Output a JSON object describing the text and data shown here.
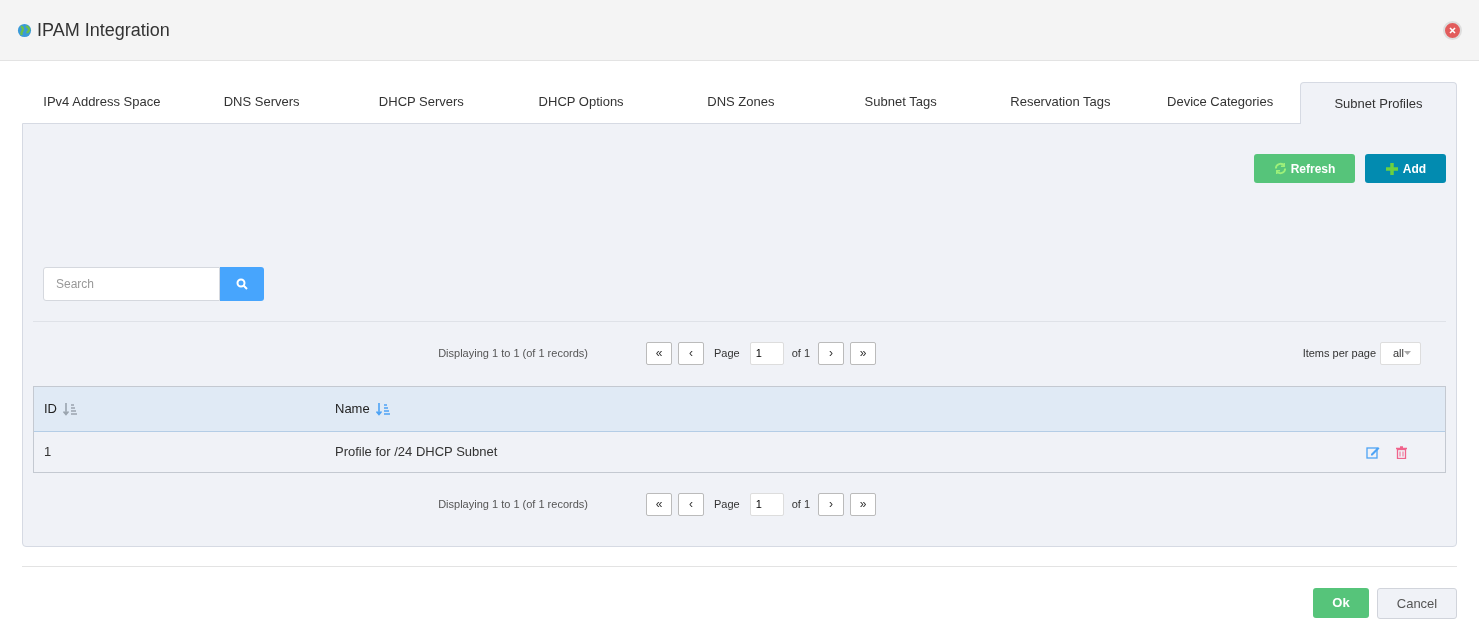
{
  "window": {
    "title": "IPAM Integration"
  },
  "tabs": [
    {
      "label": "IPv4 Address Space",
      "selected": false
    },
    {
      "label": "DNS Servers",
      "selected": false
    },
    {
      "label": "DHCP Servers",
      "selected": false
    },
    {
      "label": "DHCP Options",
      "selected": false
    },
    {
      "label": "DNS Zones",
      "selected": false
    },
    {
      "label": "Subnet Tags",
      "selected": false
    },
    {
      "label": "Reservation Tags",
      "selected": false
    },
    {
      "label": "Device Categories",
      "selected": false
    },
    {
      "label": "Subnet Profiles",
      "selected": true
    }
  ],
  "toolbar": {
    "refresh": "Refresh",
    "add": "Add"
  },
  "search": {
    "placeholder": "Search"
  },
  "pager_top": {
    "summary": "Displaying 1 to 1 (of 1 records)",
    "first": "«",
    "prev": "‹",
    "page_label": "Page",
    "page": "1",
    "of": "of 1",
    "next": "›",
    "last": "»",
    "items_label": "Items per page",
    "items_value": "all"
  },
  "table": {
    "columns": [
      {
        "label": "ID",
        "sort_active": false
      },
      {
        "label": "Name",
        "sort_active": true
      }
    ],
    "rows": [
      {
        "id": "1",
        "name": "Profile for /24 DHCP Subnet"
      }
    ]
  },
  "pager_bottom": {
    "summary": "Displaying 1 to 1 (of 1 records)",
    "first": "«",
    "prev": "‹",
    "page_label": "Page",
    "page": "1",
    "of": "of 1",
    "next": "›",
    "last": "»"
  },
  "footer": {
    "ok": "Ok",
    "cancel": "Cancel"
  }
}
